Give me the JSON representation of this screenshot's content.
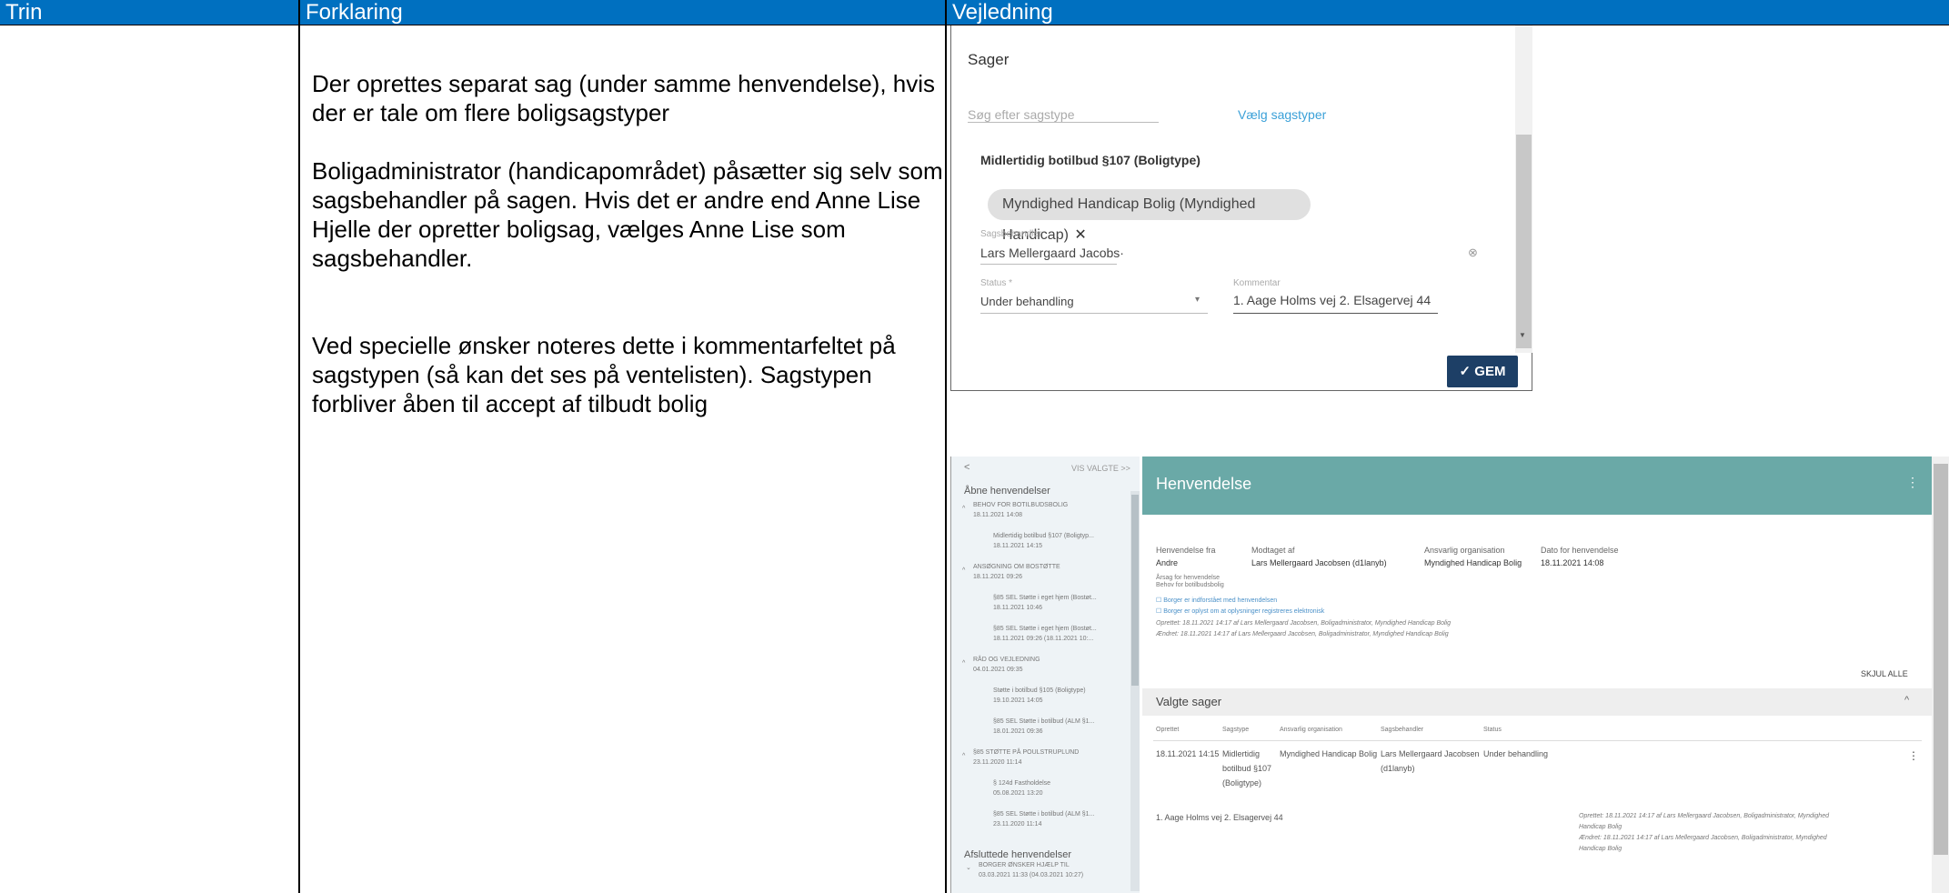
{
  "header": {
    "col1": "Trin",
    "col2": "Forklaring",
    "col3": "Vejledning"
  },
  "explanation": {
    "p1": "Der oprettes separat sag (under samme henvendelse), hvis der er tale om flere boligsagstyper",
    "p2": "Boligadministrator (handicapområdet) påsætter sig selv som sagsbehandler på sagen. Hvis det er andre end Anne Lise Hjelle der opretter boligsag, vælges Anne Lise som sagsbehandler.",
    "p3": "Ved specielle ønsker noteres dette i kommentarfeltet på sagstypen (så kan det ses på ventelisten). Sagstypen forbliver åben til accept af tilbudt bolig"
  },
  "shot1": {
    "title": "Sager",
    "search_placeholder": "Søg efter sagstype",
    "choose_link": "Vælg sagstyper",
    "case_type": "Midlertidig botilbud §107 (Boligtype)",
    "chip": "Myndighed Handicap Bolig (Myndighed Handicap)",
    "chip_close": "✕",
    "handler_label": "Sagsbehandler",
    "handler_value": "Lars Mellergaard Jacobs·",
    "status_label": "Status *",
    "status_value": "Under behandling",
    "comment_label": "Kommentar",
    "comment_value": "1. Aage Holms vej 2. Elsagervej 44",
    "save_label": "GEM"
  },
  "shot2": {
    "back": "<",
    "show_selected": "VIS VALGTE >>",
    "open_heading": "Åbne henvendelser",
    "tree": [
      {
        "title": "BEHOV FOR BOTILBUDSBOLIG",
        "date": "18.11.2021 14:08",
        "level": 0
      },
      {
        "title": "Midlertidig botilbud §107 (Boligtyp...",
        "date": "18.11.2021 14:15",
        "level": 1
      },
      {
        "title": "ANSØGNING OM BOSTØTTE",
        "date": "18.11.2021 09:26",
        "level": 0
      },
      {
        "title": "§85 SEL Støtte i eget hjem (Bostøt...",
        "date": "18.11.2021 10:46",
        "level": 1
      },
      {
        "title": "§85 SEL Støtte i eget hjem (Bostøt...",
        "date": "18.11.2021 09:26 (18.11.2021 10:...",
        "level": 1
      },
      {
        "title": "RÅD OG VEJLEDNING",
        "date": "04.01.2021 09:35",
        "level": 0
      },
      {
        "title": "Støtte i botilbud §105 (Boligtype)",
        "date": "19.10.2021 14:05",
        "level": 1
      },
      {
        "title": "§85 SEL Støtte i botilbud (ALM §1...",
        "date": "18.01.2021 09:36",
        "level": 1
      },
      {
        "title": "§85 STØTTE PÅ POULSTRUPLUND",
        "date": "23.11.2020 11:14",
        "level": 0
      },
      {
        "title": "§ 124d Fastholdelse",
        "date": "05.08.2021 13:20",
        "level": 1
      },
      {
        "title": "§85 SEL Støtte i botilbud (ALM §1...",
        "date": "23.11.2020 11:14",
        "level": 1
      }
    ],
    "closed_heading": "Afsluttede henvendelser",
    "closed_item": {
      "title": "BORGER ØNSKER HJÆLP TIL",
      "date": "03.03.2021 11:33 (04.03.2021 10:27)"
    },
    "title": "Henvendelse",
    "menu": "⋮",
    "fields": {
      "h1": "Henvendelse fra",
      "v1": "Andre",
      "h2": "Modtaget af",
      "v2": "Lars Mellergaard Jacobsen (d1lanyb)",
      "h3": "Ansvarlig organisation",
      "v3": "Myndighed Handicap Bolig",
      "h4": "Dato for henvendelse",
      "v4": "18.11.2021 14:08"
    },
    "reason_label": "Årsag for henvendelse",
    "reason_value": "Behov for botilbudsbolig",
    "check1": "Borger er indforstået med henvendelsen",
    "check2": "Borger er oplyst om at oplysninger registreres elektronisk",
    "created": "Oprettet: 18.11.2021 14:17 af Lars Mellergaard Jacobsen, Boligadministrator, Myndighed Handicap Bolig",
    "changed": "Ændret: 18.11.2021 14:17 af Lars Mellergaard Jacobsen, Boligadministrator, Myndighed Handicap Bolig",
    "hide_all": "SKJUL ALLE",
    "selected_cases": "Valgte sager",
    "collapse": "^",
    "table_headers": [
      "Oprettet",
      "Sagstype",
      "Ansvarlig organisation",
      "Sagsbehandler",
      "Status"
    ],
    "row": {
      "created": "18.11.2021 14:15",
      "type1": "Midlertidig",
      "type2": "botilbud §107",
      "type3": "(Boligtype)",
      "org": "Myndighed Handicap Bolig",
      "handler1": "Lars Mellergaard Jacobsen",
      "handler2": "(d1lanyb)",
      "status": "Under behandling"
    },
    "comment": "1. Aage Holms vej 2. Elsagervej 44",
    "row_created1": "Oprettet: 18.11.2021 14:17 af Lars Mellergaard Jacobsen, Boligadministrator, Myndighed",
    "row_created2": "Handicap Bolig",
    "row_changed1": "Ændret: 18.11.2021 14:17 af Lars Mellergaard Jacobsen, Boligadministrator, Myndighed",
    "row_changed2": "Handicap Bolig"
  }
}
